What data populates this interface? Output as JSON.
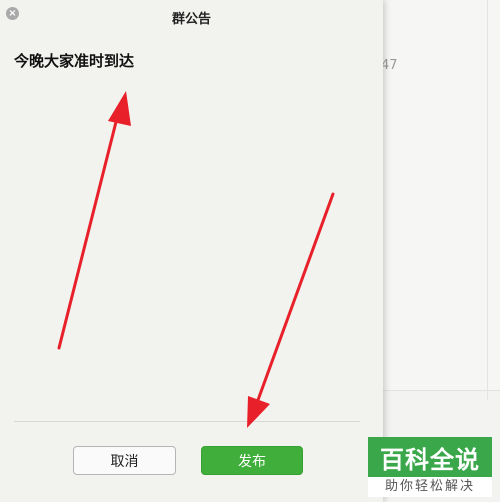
{
  "dialog": {
    "title": "群公告",
    "close_symbol": "×",
    "notice_text": "今晚大家准时到达",
    "cancel_label": "取消",
    "publish_label": "发布"
  },
  "background": {
    "fragment_text": "47"
  },
  "annotations": {
    "arrow_color": "#e8202a"
  },
  "watermark": {
    "top_text": "百科全说",
    "bottom_text": "助你轻松解决",
    "brand_color": "#3aa84a"
  }
}
